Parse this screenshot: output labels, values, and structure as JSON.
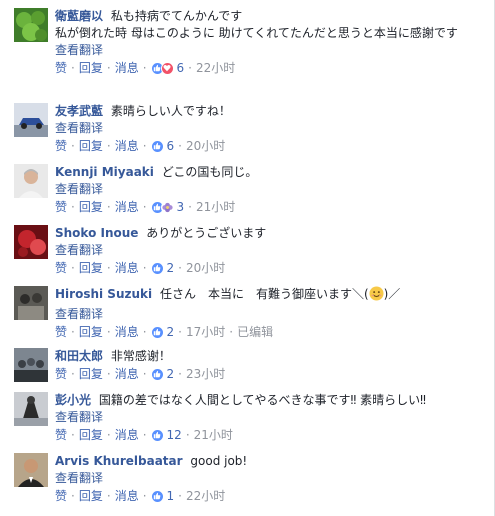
{
  "labels": {
    "like": "赞",
    "reply": "回复",
    "message": "消息",
    "translate": "查看翻译",
    "dot": "·"
  },
  "colors": {
    "link": "#365899",
    "action": "#4267b2",
    "meta": "#90949c",
    "like_icon": "#5890ff",
    "love_icon": "#f25268"
  },
  "comments": [
    {
      "author": "衛藍磨以",
      "text": "私も持病でてんかんです",
      "text2": "私が倒れた時 母はこのように 助けてくれてたんだと思うと本当に感謝です",
      "reactions": [
        "like",
        "love"
      ],
      "count": "6",
      "time": "22小时",
      "avatar": "green-leaf-avatar"
    },
    {
      "author": "友孝武藍",
      "text": "素晴らしい人ですね！",
      "reactions": [
        "like"
      ],
      "count": "6",
      "time": "20小时",
      "avatar": "car-avatar"
    },
    {
      "author": "Kennji Miyaaki",
      "text": "どこの国も同じ。",
      "reactions": [
        "like",
        "haha"
      ],
      "count": "3",
      "time": "21小时",
      "avatar": "man-portrait-avatar"
    },
    {
      "author": "Shoko Inoue",
      "text": "ありがとうございます",
      "reactions": [
        "like"
      ],
      "count": "2",
      "time": "20小时",
      "avatar": "red-floral-avatar"
    },
    {
      "author": "Hiroshi Suzuki",
      "text_a": "任さん　本当に　有難う御座います＼(",
      "text_b": ")／",
      "reactions": [
        "like"
      ],
      "count": "2",
      "time": "17小时",
      "edited": "已编辑",
      "avatar": "dark-group-avatar"
    },
    {
      "author": "和田太郎",
      "text": "非常感谢！",
      "reactions": [
        "like"
      ],
      "count": "2",
      "time": "23小时",
      "avatar": "crowd-avatar"
    },
    {
      "author": "彭小光",
      "text": "国籍の差ではなく人間としてやるべきな事です‼ 素晴らしい‼",
      "reactions": [
        "like"
      ],
      "count": "12",
      "time": "21小时",
      "avatar": "sports-avatar"
    },
    {
      "author": "Arvis Khurelbaatar",
      "text": "good job!",
      "reactions": [
        "like"
      ],
      "count": "1",
      "time": "22小时",
      "avatar": "man-suit-avatar"
    }
  ]
}
